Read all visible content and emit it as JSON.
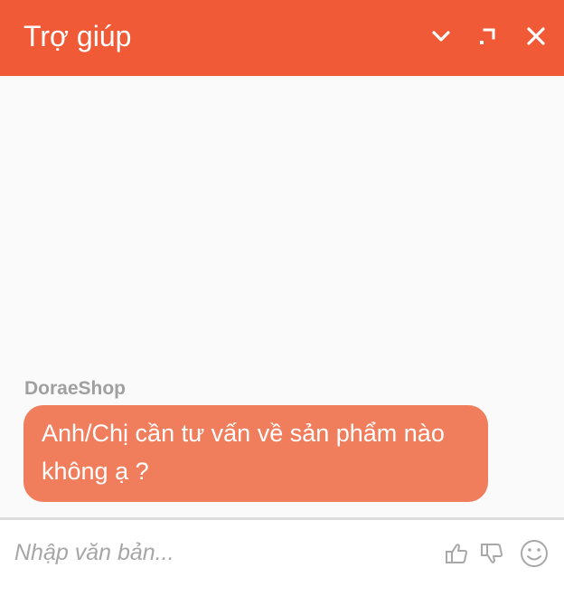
{
  "header": {
    "title": "Trợ giúp",
    "icons": [
      "chevron-down-icon",
      "expand-icon",
      "close-icon"
    ],
    "background_color": "#f05a37"
  },
  "conversation": {
    "messages": [
      {
        "sender": "DoraeShop",
        "text": "Anh/Chị cần tư vấn về sản phẩm nào không ạ ?",
        "bubble_color": "#f07d5c"
      }
    ]
  },
  "composer": {
    "placeholder": "Nhập văn bản...",
    "value": "",
    "icons": [
      "thumbs-up-icon",
      "thumbs-down-icon",
      "emoji-icon"
    ]
  }
}
